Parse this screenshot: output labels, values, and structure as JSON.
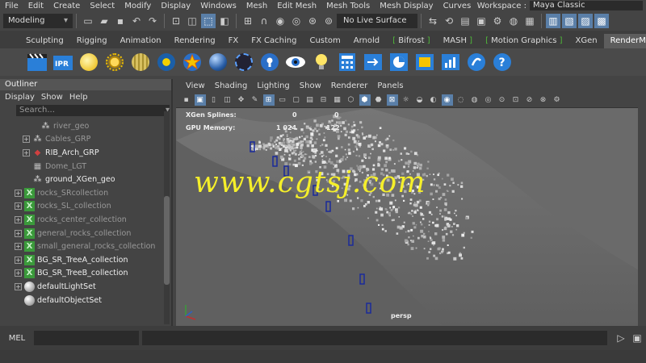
{
  "menubar": {
    "items": [
      "File",
      "Edit",
      "Create",
      "Select",
      "Modify",
      "Display",
      "Windows",
      "Mesh",
      "Edit Mesh",
      "Mesh Tools",
      "Mesh Display",
      "Curves"
    ],
    "workspace_label": "Workspace :",
    "workspace_value": "Maya Classic"
  },
  "statusline": {
    "mode": "Modeling",
    "live_surface": "No Live Surface"
  },
  "shelf_tabs": [
    "Sculpting",
    "Rigging",
    "Animation",
    "Rendering",
    "FX",
    "FX Caching",
    "Custom",
    "Arnold",
    "Bifrost",
    "MASH",
    "Motion Graphics",
    "XGen",
    "RenderMan"
  ],
  "shelf_selected": "RenderMan",
  "outliner": {
    "title": "Outliner",
    "menu": [
      "Display",
      "Show",
      "Help"
    ],
    "search_placeholder": "Search...",
    "rows": [
      {
        "label": "river_geo",
        "indent": 2,
        "expand": false,
        "icon": "group",
        "tone": "gray"
      },
      {
        "label": "Cables_GRP",
        "indent": 1,
        "expand": true,
        "icon": "group",
        "tone": "gray"
      },
      {
        "label": "RIB_Arch_GRP",
        "indent": 1,
        "expand": true,
        "icon": "rib",
        "tone": "white"
      },
      {
        "label": "Dome_LGT",
        "indent": 1,
        "expand": false,
        "icon": "light",
        "tone": "gray"
      },
      {
        "label": "ground_XGen_geo",
        "indent": 1,
        "expand": false,
        "icon": "group",
        "tone": "white"
      },
      {
        "label": "rocks_SRcollection",
        "indent": 0,
        "expand": true,
        "icon": "xgen",
        "tone": "gray"
      },
      {
        "label": "rocks_SL_collection",
        "indent": 0,
        "expand": true,
        "icon": "xgen",
        "tone": "gray"
      },
      {
        "label": "rocks_center_collection",
        "indent": 0,
        "expand": true,
        "icon": "xgen",
        "tone": "gray"
      },
      {
        "label": "general_rocks_collection",
        "indent": 0,
        "expand": true,
        "icon": "xgen",
        "tone": "gray"
      },
      {
        "label": "small_general_rocks_collection",
        "indent": 0,
        "expand": true,
        "icon": "xgen",
        "tone": "gray"
      },
      {
        "label": "BG_SR_TreeA_collection",
        "indent": 0,
        "expand": true,
        "icon": "xgen",
        "tone": "white"
      },
      {
        "label": "BG_SR_TreeB_collection",
        "indent": 0,
        "expand": true,
        "icon": "xgen",
        "tone": "white"
      },
      {
        "label": "defaultLightSet",
        "indent": 0,
        "expand": true,
        "icon": "set",
        "tone": "white"
      },
      {
        "label": "defaultObjectSet",
        "indent": 0,
        "expand": false,
        "icon": "set",
        "tone": "white"
      }
    ]
  },
  "viewport": {
    "menu": [
      "View",
      "Shading",
      "Lighting",
      "Show",
      "Renderer",
      "Panels"
    ],
    "hud_splines_label": "XGen Splines:",
    "hud_splines_a": "0",
    "hud_splines_b": "0",
    "hud_gpu_label": "GPU Memory:",
    "hud_gpu_a": "1 024",
    "hud_gpu_b": "122",
    "camera": "persp",
    "watermark": "www.cgtsj.com"
  },
  "cmdline": {
    "label": "MEL"
  },
  "colors": {
    "accent": "#5a7fa8",
    "xgen_green": "#3b9a3b",
    "watermark": "#f5ef2a"
  }
}
